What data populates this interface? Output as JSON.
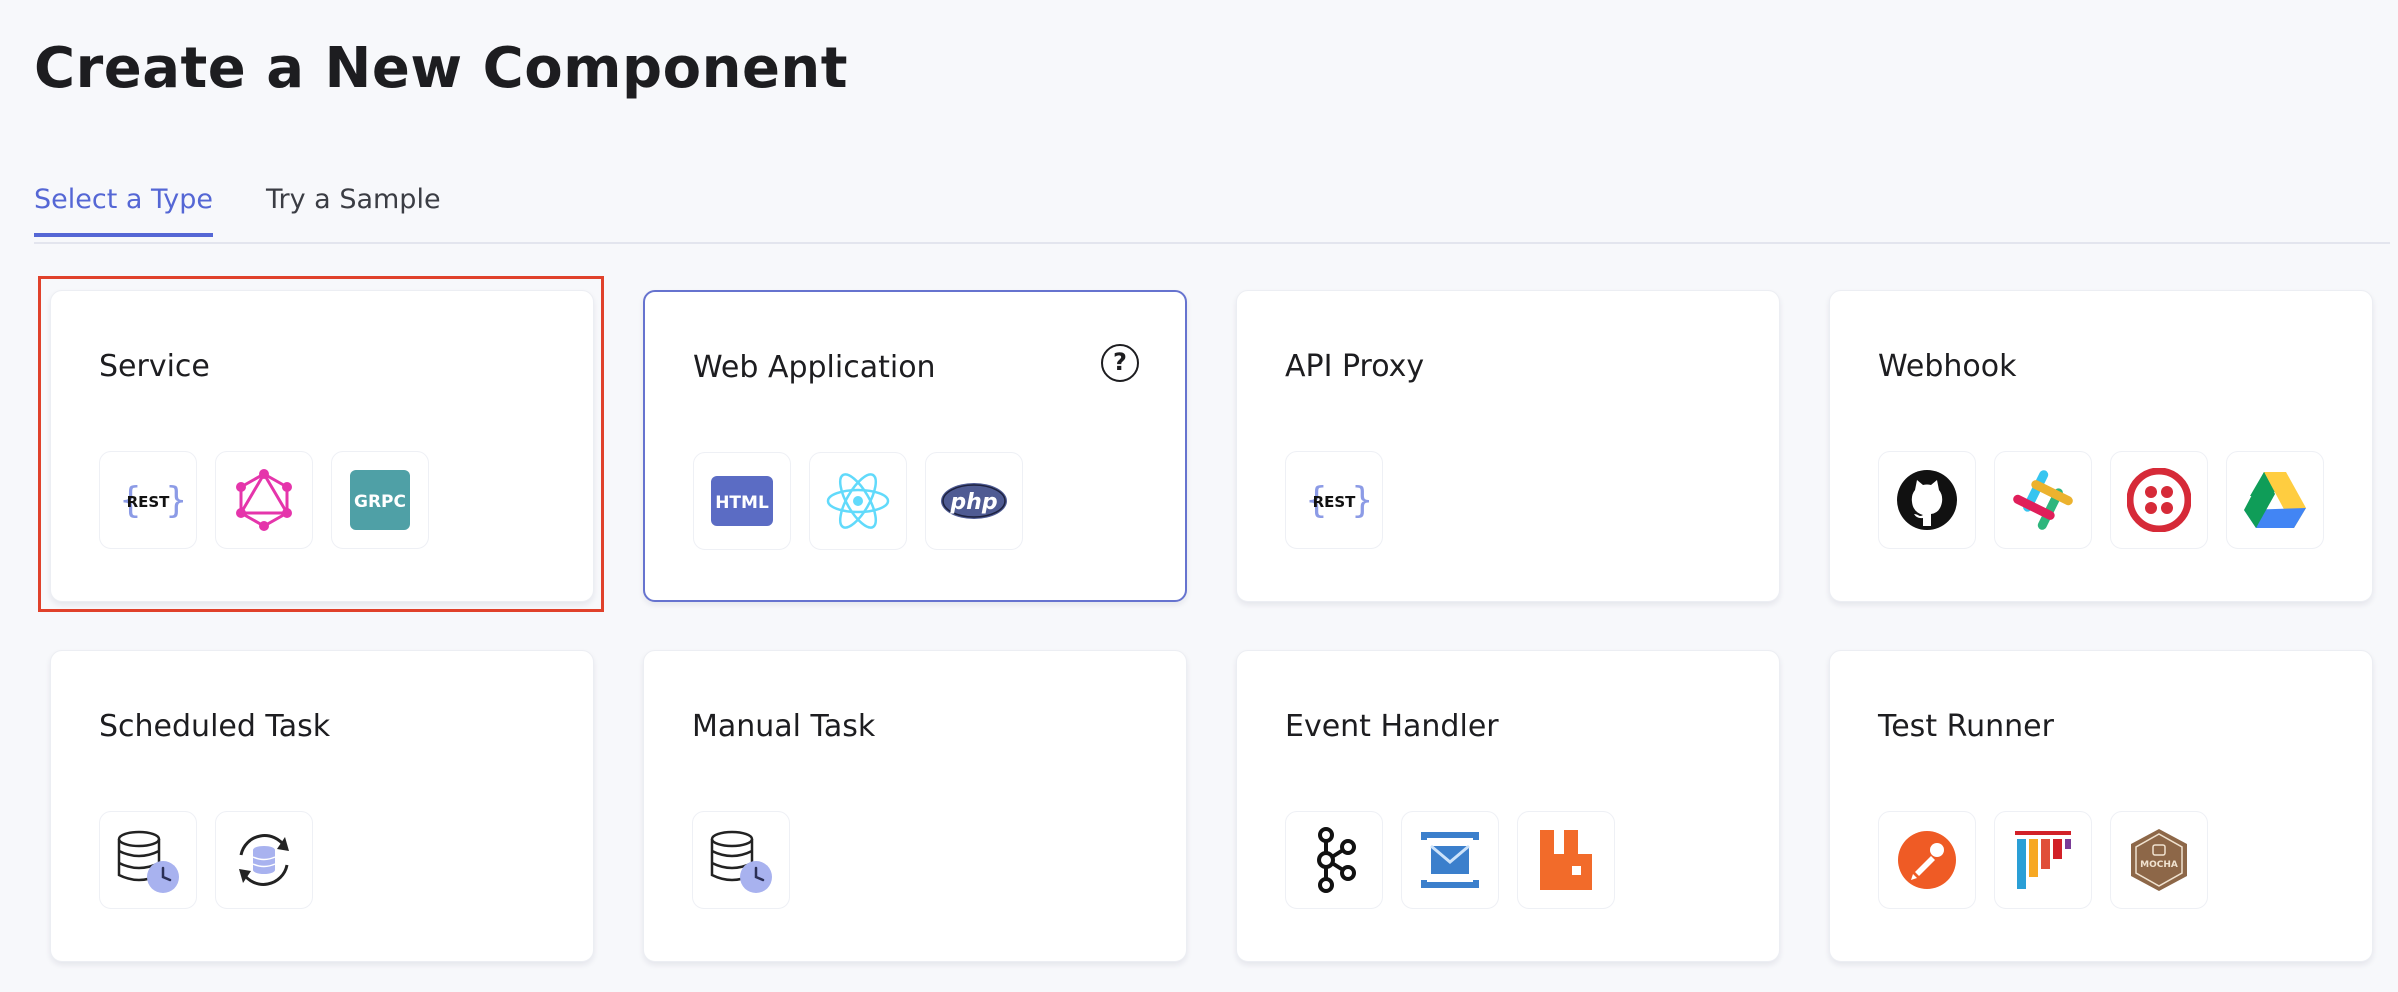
{
  "page": {
    "title": "Create a New Component"
  },
  "tabs": [
    {
      "label": "Select a Type",
      "active": true
    },
    {
      "label": "Try a Sample",
      "active": false
    }
  ],
  "cards": [
    {
      "title": "Service",
      "icons": [
        "rest-icon",
        "graphql-icon",
        "grpc-icon"
      ],
      "icon_labels": {
        "rest": "REST",
        "grpc": "GRPC"
      }
    },
    {
      "title": "Web Application",
      "icons": [
        "html-icon",
        "react-icon",
        "php-icon"
      ],
      "icon_labels": {
        "html": "HTML",
        "php": "php"
      },
      "help": "?"
    },
    {
      "title": "API Proxy",
      "icons": [
        "rest-icon"
      ],
      "icon_labels": {
        "rest": "REST"
      }
    },
    {
      "title": "Webhook",
      "icons": [
        "github-icon",
        "slack-icon",
        "twilio-icon",
        "google-drive-icon"
      ]
    },
    {
      "title": "Scheduled Task",
      "icons": [
        "database-clock-icon",
        "database-sync-icon"
      ]
    },
    {
      "title": "Manual Task",
      "icons": [
        "database-clock-icon"
      ]
    },
    {
      "title": "Event Handler",
      "icons": [
        "kafka-icon",
        "azure-service-bus-icon",
        "rabbitmq-icon"
      ]
    },
    {
      "title": "Test Runner",
      "icons": [
        "postman-icon",
        "jmeter-icon",
        "mocha-icon"
      ],
      "icon_labels": {
        "mocha": "MOCHA"
      }
    }
  ],
  "colors": {
    "accent": "#5567d5",
    "hover_border": "#6673cf",
    "highlight": "#e0412b",
    "grpc": "#4fa0a6",
    "graphql": "#e535ab",
    "html": "#5b6cc4",
    "react": "#61dafb",
    "php": "#4f5b93"
  }
}
